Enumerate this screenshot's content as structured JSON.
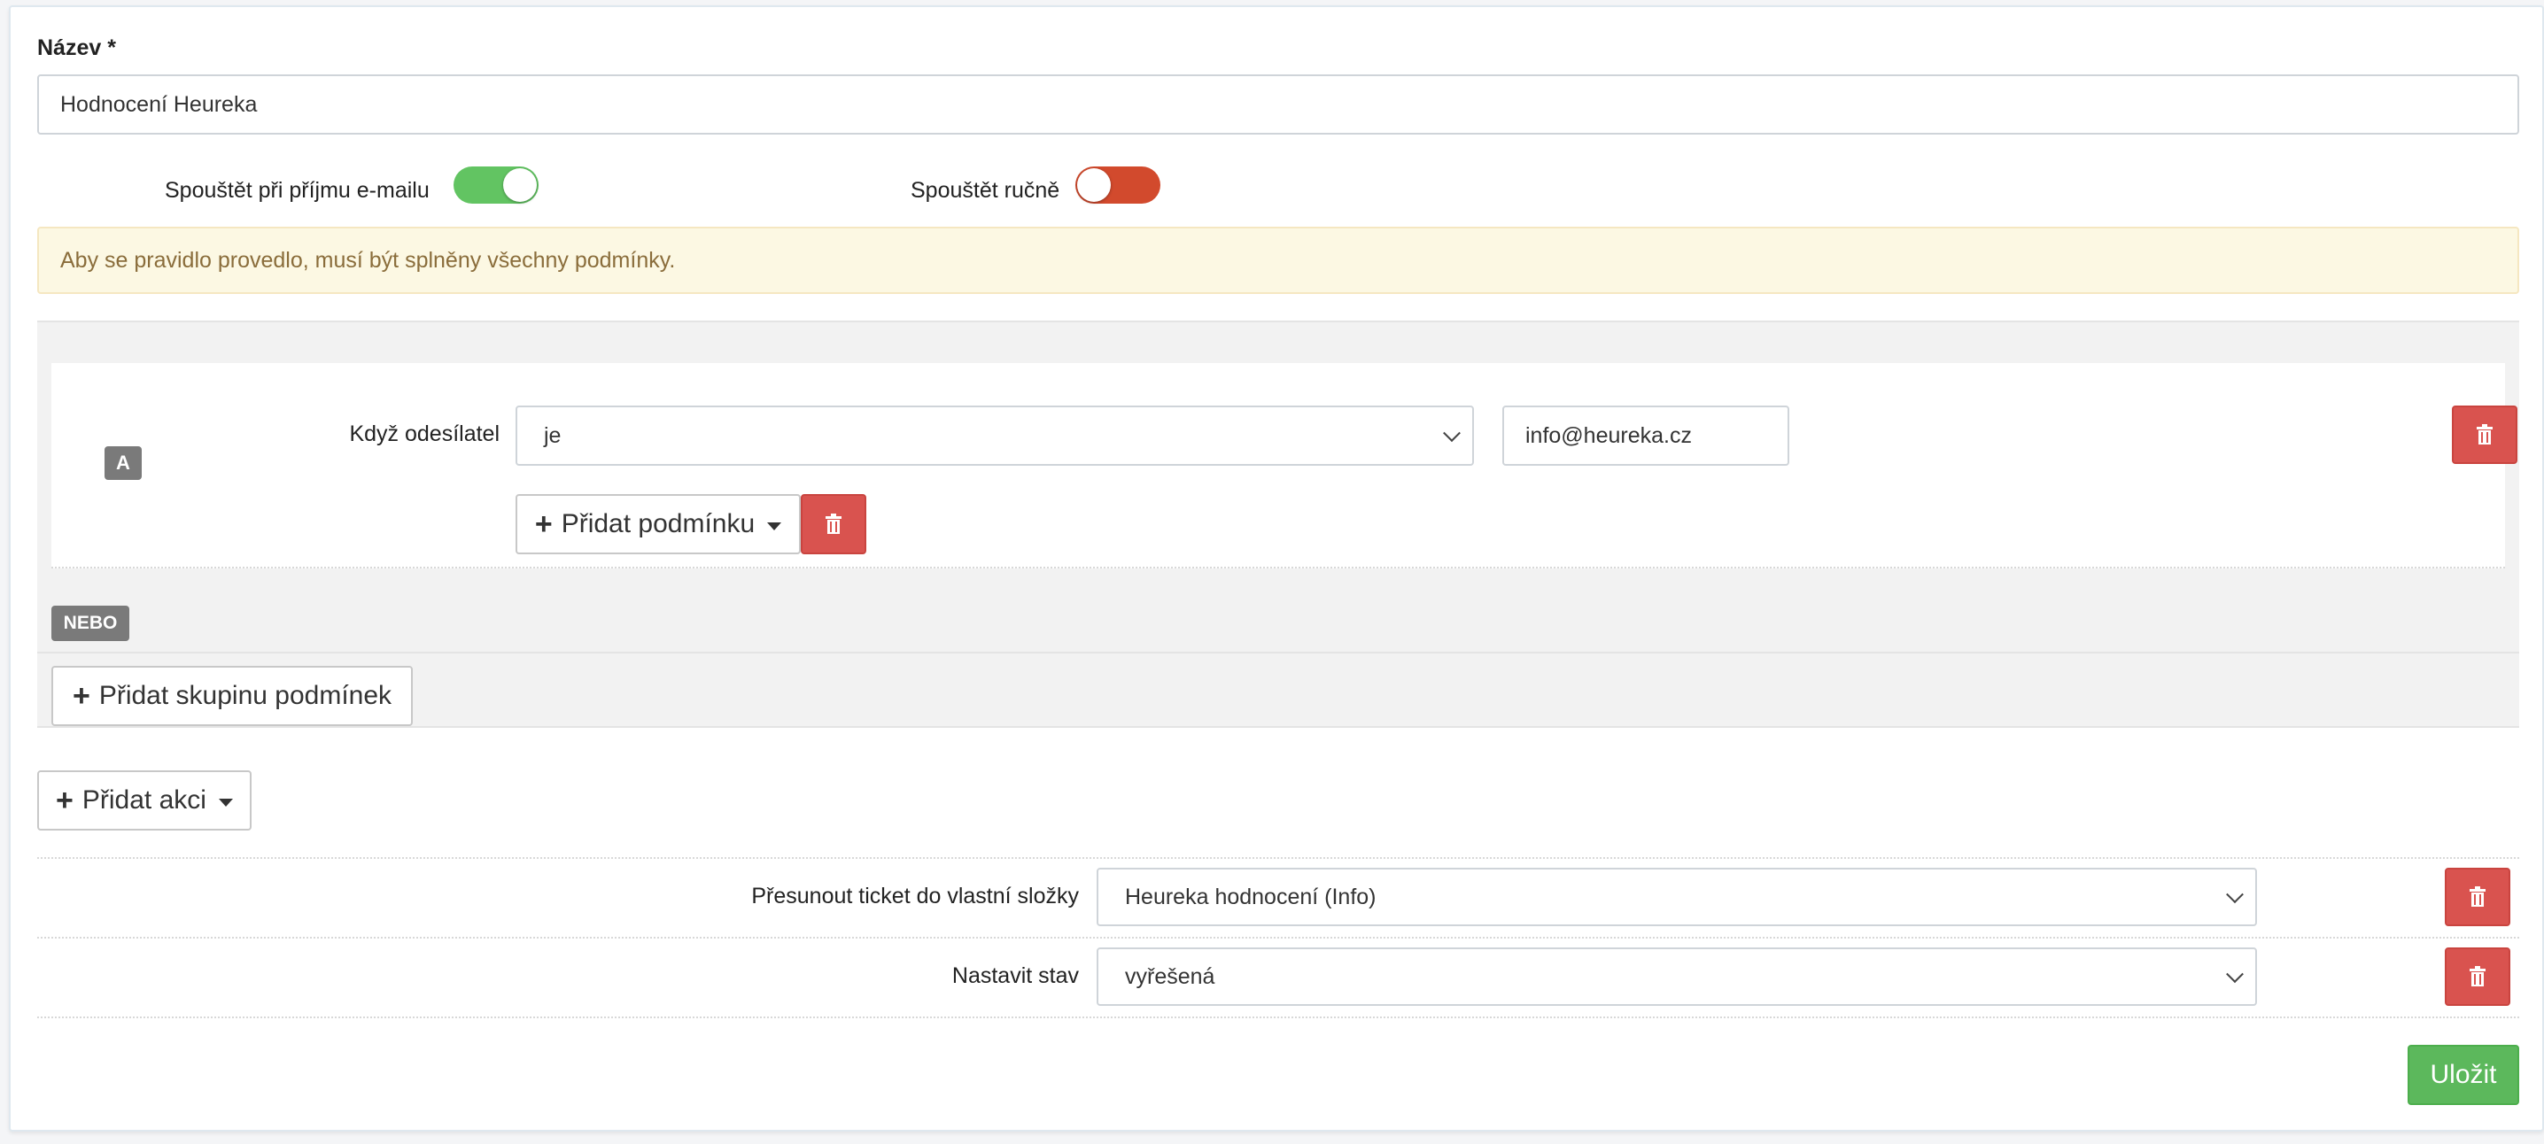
{
  "form": {
    "name_label": "Název",
    "required_mark": "*",
    "name_value": "Hodnocení Heureka"
  },
  "toggles": {
    "on_email": {
      "label": "Spouštět při příjmu e-mailu",
      "state": "on",
      "color": "#62c462"
    },
    "manual": {
      "label": "Spouštět ručně",
      "state": "off",
      "color": "#d24a2d"
    }
  },
  "alert": {
    "text": "Aby se pravidlo provedlo, musí být splněny všechny podmínky."
  },
  "conditions": {
    "group_badge": "A",
    "condition_label": "Když odesílatel",
    "operator_value": "je",
    "match_value": "info@heureka.cz",
    "add_condition_label": "Přidat podmínku",
    "or_badge": "NEBO",
    "add_group_label": "Přidat skupinu podmínek"
  },
  "actions": {
    "add_action_label": "Přidat akci",
    "rows": [
      {
        "label": "Přesunout ticket do vlastní složky",
        "value": "Heureka hodnocení (Info)"
      },
      {
        "label": "Nastavit stav",
        "value": "vyřešená"
      }
    ]
  },
  "footer": {
    "save_label": "Uložit"
  },
  "colors": {
    "danger": "#d9534f",
    "success": "#5cb85c",
    "alert_bg": "#fcf8e3"
  },
  "icons": {
    "trash": "trash-icon",
    "plus": "plus-icon",
    "caret": "caret-down-icon",
    "chevron": "chevron-down-icon"
  }
}
